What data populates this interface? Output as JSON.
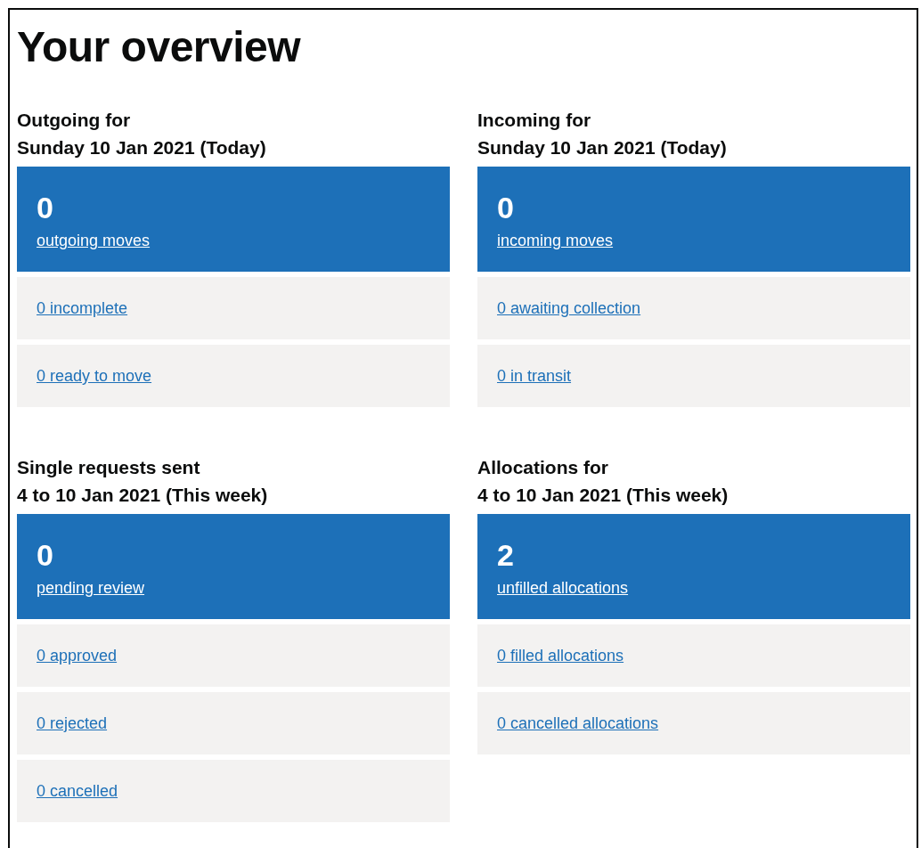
{
  "title": "Your overview",
  "sections": [
    {
      "heading": [
        "Outgoing for",
        "Sunday 10 Jan 2021 (Today)"
      ],
      "count": "0",
      "count_link": "outgoing moves",
      "links": [
        "0 incomplete",
        "0 ready to move"
      ]
    },
    {
      "heading": [
        "Incoming for",
        "Sunday 10 Jan 2021 (Today)"
      ],
      "count": "0",
      "count_link": "incoming moves",
      "links": [
        "0 awaiting collection",
        "0 in transit"
      ]
    },
    {
      "heading": [
        "Single requests sent",
        "4 to 10 Jan 2021 (This week)"
      ],
      "count": "0",
      "count_link": "pending review",
      "links": [
        "0 approved",
        "0 rejected",
        "0 cancelled"
      ]
    },
    {
      "heading": [
        "Allocations for",
        "4 to 10 Jan 2021 (This week)"
      ],
      "count": "2",
      "count_link": "unfilled allocations",
      "links": [
        "0 filled allocations",
        "0 cancelled allocations"
      ]
    }
  ]
}
